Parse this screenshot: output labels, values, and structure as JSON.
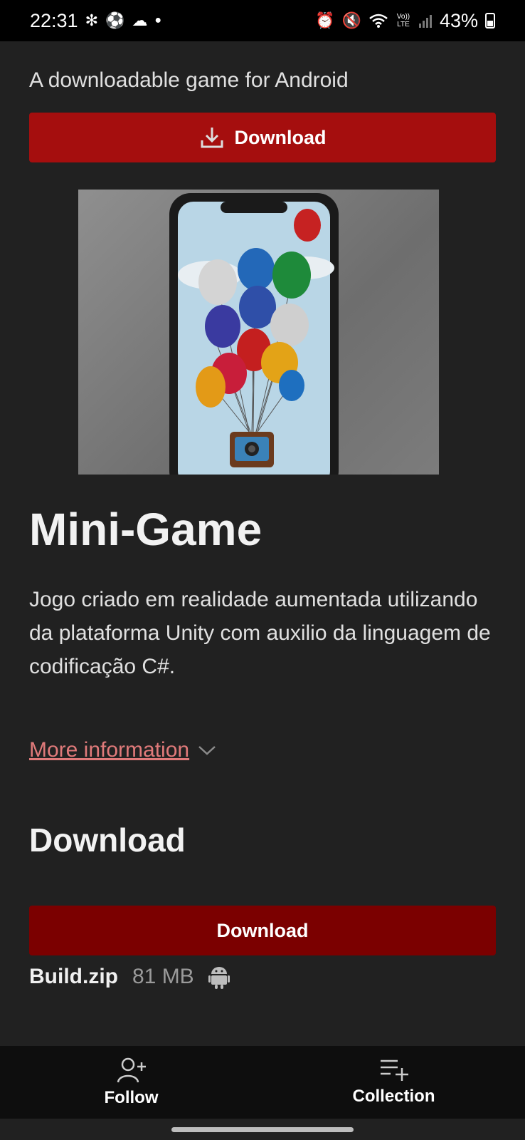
{
  "status_bar": {
    "time": "22:31",
    "battery": "43%",
    "icons_left": [
      "fan-icon",
      "soccer-ball-icon",
      "cloud-icon",
      "dot-icon"
    ],
    "icons_right": [
      "alarm-icon",
      "mute-icon",
      "wifi-icon",
      "volte-icon",
      "signal-icon",
      "battery-icon"
    ],
    "volte_label": "Vo)) LTE"
  },
  "page": {
    "subtitle": "A downloadable game for Android",
    "top_download_label": "Download",
    "cover_alt": "Phone with colorful balloons",
    "title": "Mini-Game",
    "description": "Jogo criado em realidade aumentada utilizando da plataforma Unity com auxilio da linguagem de codificação C#.",
    "more_info_label": "More information",
    "download_section_title": "Download",
    "bottom_download_label": "Download",
    "file": {
      "name": "Build.zip",
      "size": "81 MB",
      "platform_icon": "android-icon"
    }
  },
  "bottom_nav": {
    "follow_label": "Follow",
    "collection_label": "Collection"
  },
  "colors": {
    "background": "#212121",
    "primary_button": "#a50e0e",
    "secondary_button": "#7b0000",
    "link": "#e07a7a"
  }
}
